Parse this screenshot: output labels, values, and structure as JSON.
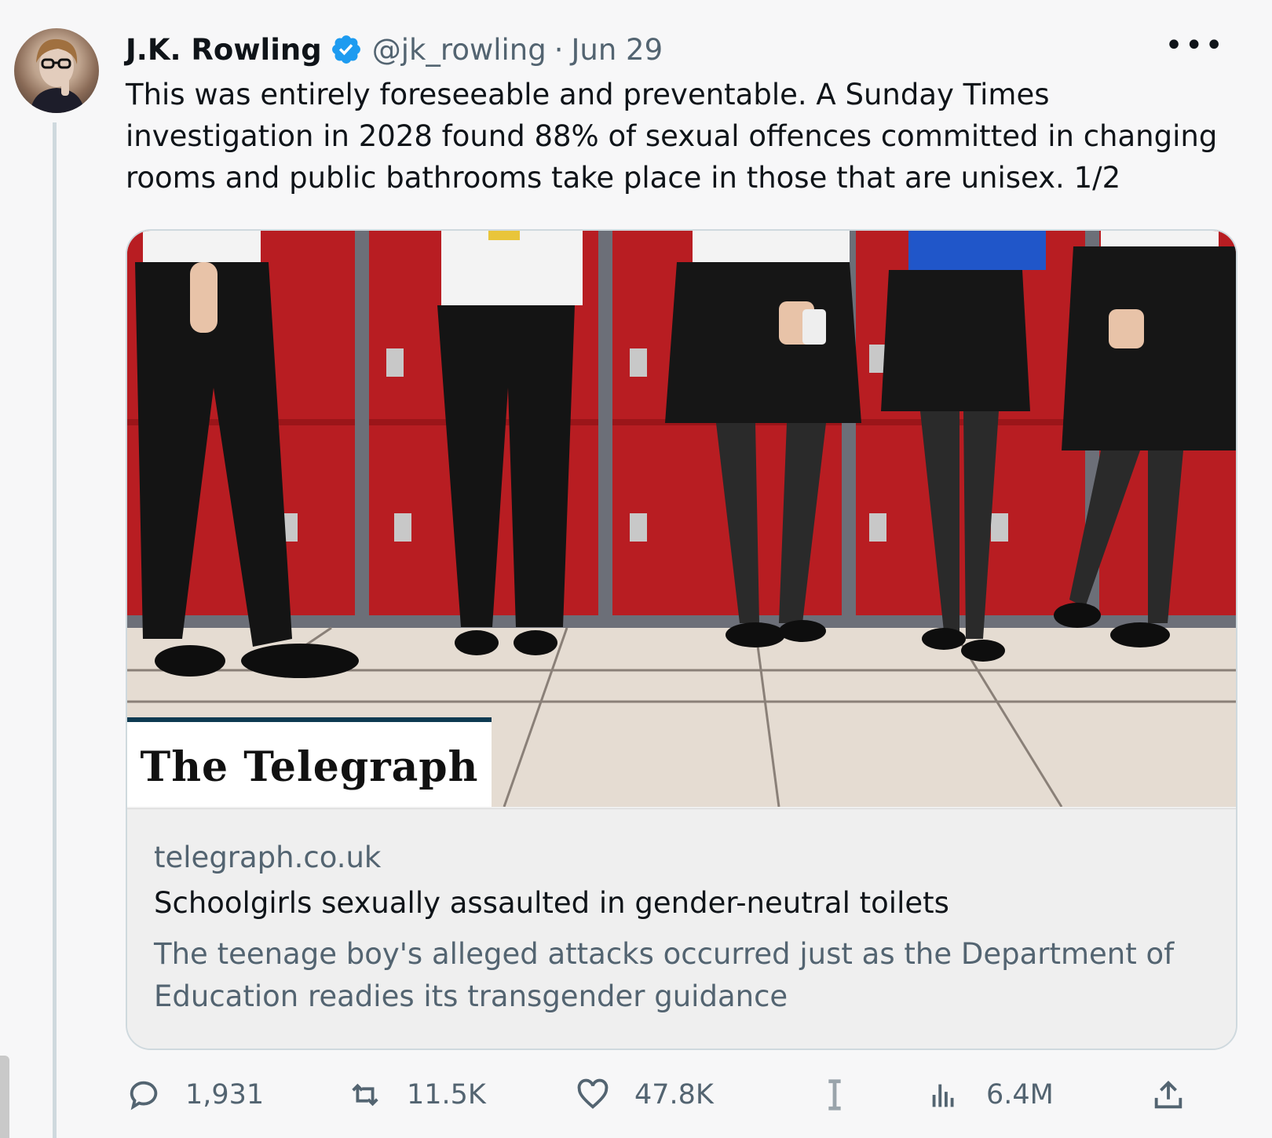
{
  "tweet": {
    "author_name": "J.K. Rowling",
    "handle": "@jk_rowling",
    "separator": "·",
    "date": "Jun 29",
    "more_label": "•••",
    "text": "This was entirely foreseeable and preventable. A Sunday Times investigation in 2028 found 88% of sexual offences committed in changing rooms and public bathrooms take place in those that are unisex. 1/2"
  },
  "card": {
    "image_overlay_logo": "The Telegraph",
    "domain": "telegraph.co.uk",
    "headline": "Schoolgirls sexually assaulted in gender-neutral toilets",
    "description": "The teenage boy's alleged attacks occurred just as the Department of Education readies its transgender guidance"
  },
  "actions": {
    "replies": "1,931",
    "reposts": "11.5K",
    "likes": "47.8K",
    "views": "6.4M"
  },
  "colors": {
    "verified_blue": "#1d9bf0",
    "muted_text": "#536471",
    "primary_text": "#0f1419",
    "locker_red": "#b81d22"
  },
  "icons": {
    "reply": "speech-bubble-icon",
    "repost": "repost-arrows-icon",
    "like": "heart-icon",
    "text_cursor": "text-cursor-icon",
    "views": "bar-chart-icon",
    "share": "share-upload-icon"
  }
}
